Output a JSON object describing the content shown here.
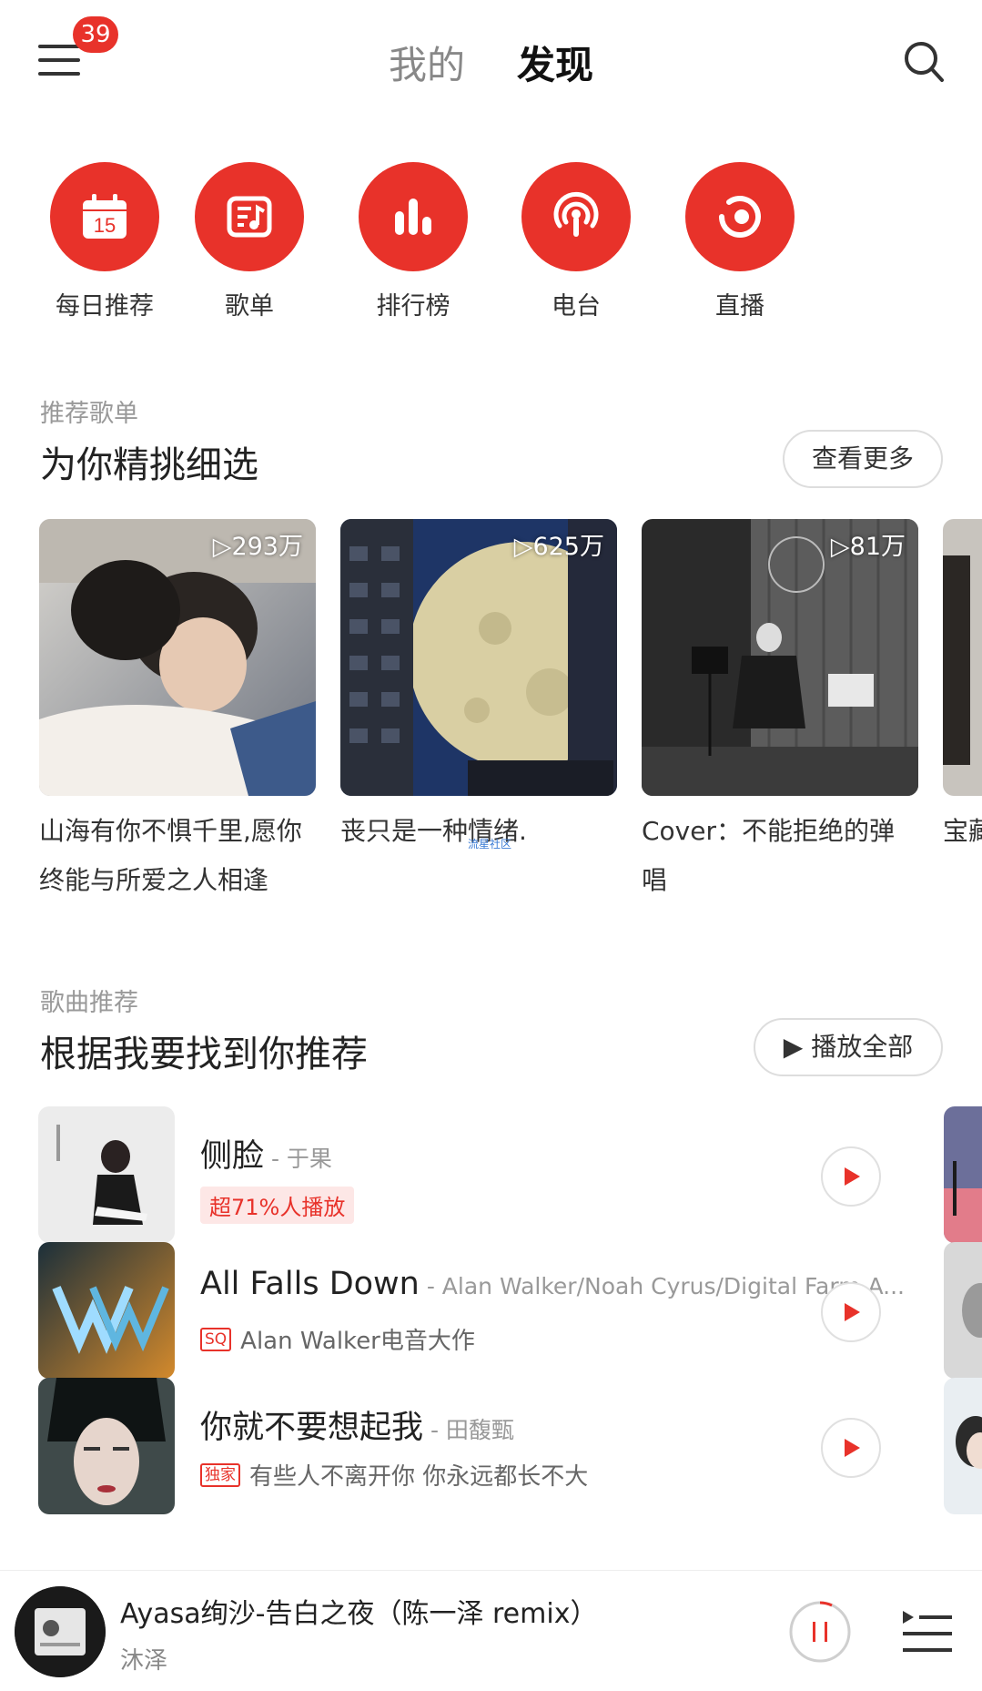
{
  "header": {
    "notification_count": "39",
    "tabs": [
      {
        "label": "我的",
        "active": false
      },
      {
        "label": "发现",
        "active": true
      }
    ]
  },
  "quick_nav": [
    {
      "label": "每日推荐",
      "icon": "calendar-icon",
      "calendar_day": "15"
    },
    {
      "label": "歌单",
      "icon": "playlist-icon"
    },
    {
      "label": "排行榜",
      "icon": "chart-bars-icon"
    },
    {
      "label": "电台",
      "icon": "radio-icon"
    },
    {
      "label": "直播",
      "icon": "live-icon"
    }
  ],
  "playlists_section": {
    "subtitle": "推荐歌单",
    "title": "为你精挑细选",
    "more_label": "查看更多",
    "cards": [
      {
        "title": "山海有你不惧千里,愿你终能与所爱之人相逢",
        "play_count": "▷293万"
      },
      {
        "title": "丧只是一种情绪.",
        "play_count": "▷625万"
      },
      {
        "title": "Cover：不能拒绝的弹唱",
        "play_count": "▷81万"
      },
      {
        "title": "宝藏业",
        "play_count": ""
      }
    ],
    "watermark": "流星社区"
  },
  "songs_section": {
    "subtitle": "歌曲推荐",
    "title": "根据我要找到你推荐",
    "play_all_label": "▶ 播放全部",
    "songs": [
      {
        "title": "侧脸",
        "artist": " - 于果",
        "tag": "超71%人播放",
        "tag_type": "hot",
        "desc": ""
      },
      {
        "title": "All Falls Down",
        "artist": " - Alan Walker/Noah Cyrus/Digital Farm A...",
        "tag": "SQ",
        "tag_type": "box",
        "desc": "Alan Walker电音大作"
      },
      {
        "title": "你就不要想起我",
        "artist": " - 田馥甄",
        "tag": "独家",
        "tag_type": "box",
        "desc": "有些人不离开你 你永远都长不大"
      }
    ]
  },
  "player": {
    "title": "Ayasa绚沙-告白之夜（陈一泽 remix）",
    "artist": "沐泽"
  },
  "colors": {
    "accent": "#e8322a",
    "text_primary": "#222222",
    "text_secondary": "#999999"
  }
}
